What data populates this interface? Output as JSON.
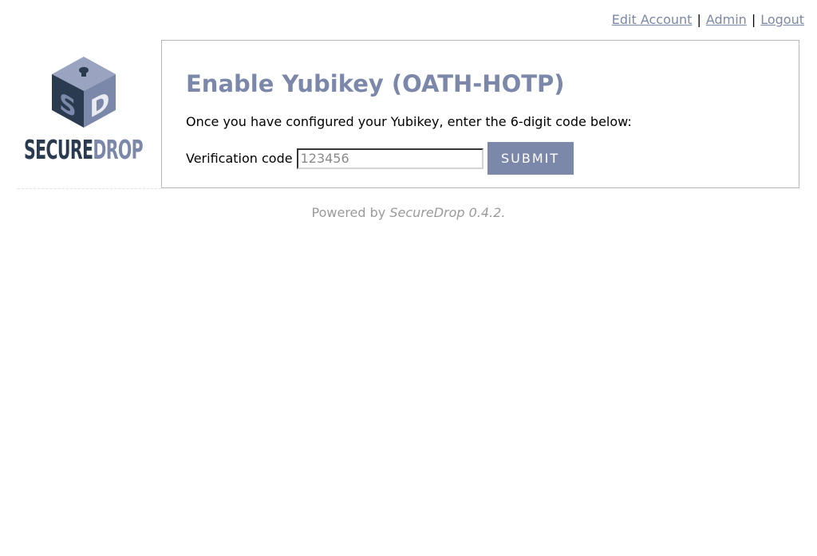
{
  "nav": {
    "edit_account": "Edit Account",
    "separator": "|",
    "admin": "Admin",
    "logout": "Logout"
  },
  "logo": {
    "cube_letters": [
      "S",
      "D"
    ],
    "word_secure": "SECURE",
    "word_drop": "DROP"
  },
  "main": {
    "title": "Enable Yubikey (OATH-HOTP)",
    "instructions": "Once you have configured your Yubikey, enter the 6-digit code below:",
    "form": {
      "label": "Verification code",
      "input_value": "",
      "input_placeholder": "123456",
      "submit_label": "SUBMIT"
    }
  },
  "footer": {
    "prefix": "Powered by ",
    "product": "SecureDrop 0.4.2",
    "suffix": "."
  },
  "colors": {
    "accent": "#7c88a9",
    "dark": "#2a3a4f",
    "muted": "#9a9a9a",
    "border": "#b8b8b8"
  }
}
